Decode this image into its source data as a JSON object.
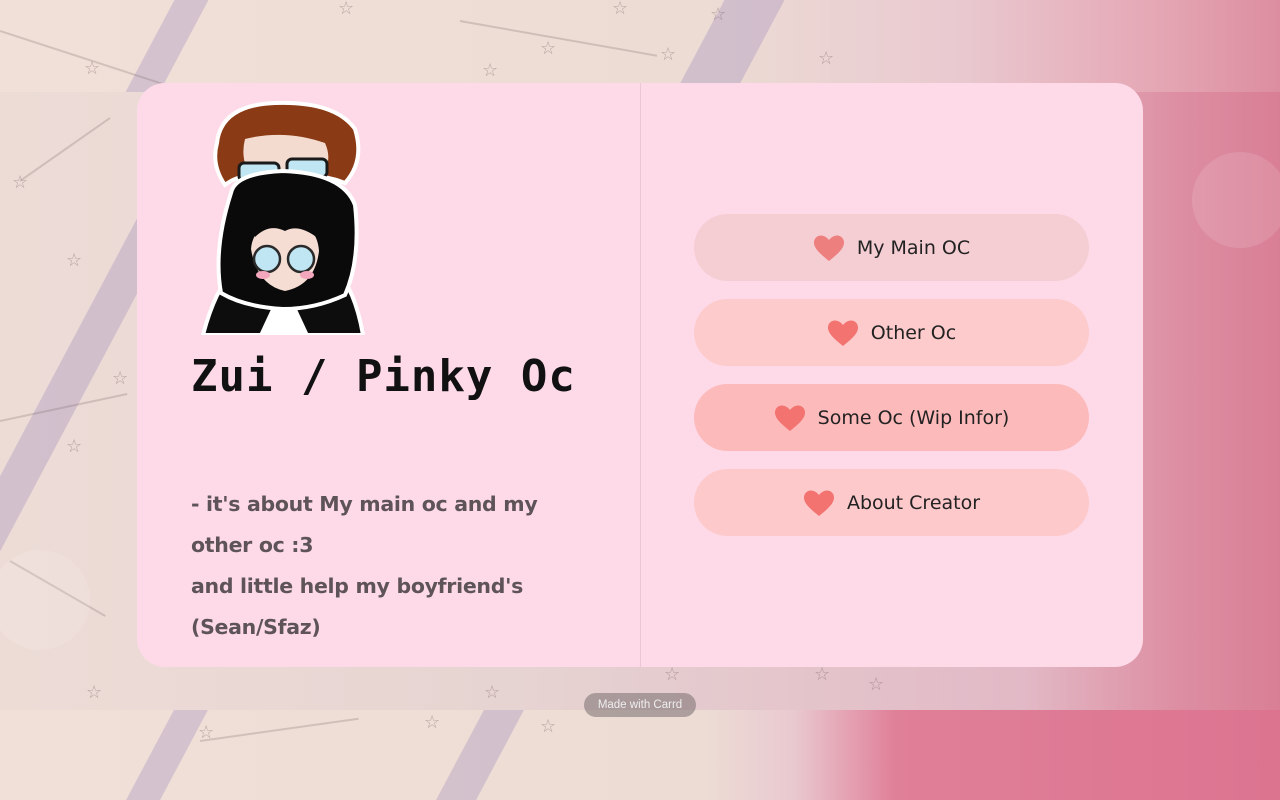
{
  "profile": {
    "title": "Zui / Pinky Oc",
    "description": [
      "- it's about My main oc and my other oc :3",
      "and little help my boyfriend's (Sean/Sfaz)"
    ]
  },
  "links": [
    {
      "label": "My Main OC",
      "icon": "heart-icon"
    },
    {
      "label": "Other Oc",
      "icon": "heart-icon"
    },
    {
      "label": "Some Oc (Wip Infor)",
      "icon": "heart-icon"
    },
    {
      "label": "About Creator",
      "icon": "heart-icon"
    }
  ],
  "footer": {
    "badge_label": "Made with Carrd"
  },
  "colors": {
    "card_background": "#fedae8",
    "heart": "#f2736f",
    "button_1": "#f5ced4",
    "button_2": "#fdcbcc",
    "button_3": "#fdbabb",
    "button_4": "#fdc9cb",
    "title_text": "#111111",
    "description_text": "#5e5458"
  }
}
